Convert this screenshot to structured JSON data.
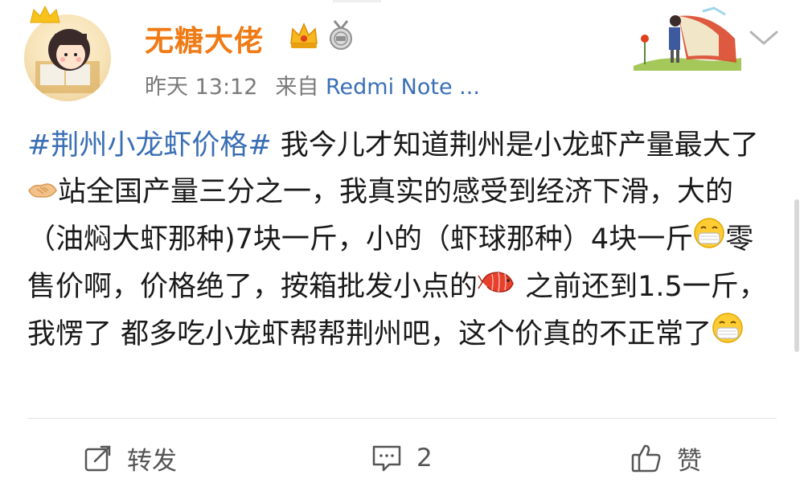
{
  "post": {
    "username": "无糖大佬",
    "time": "昨天 13:12",
    "source_prefix": "来自",
    "source_device": "Redmi Note ...",
    "content": {
      "topic": "#荆州小龙虾价格#",
      "seg1": " 我今儿才知道荆州是小龙虾产量最大了",
      "seg2": "站全国产量三分之一，我真实的感受到经济下滑，大的 （油焖大虾那种)7块一斤，小的（虾球那种）4块一斤",
      "seg3": "零售价啊，价格绝了，按箱批发小点的",
      "seg4": " 之前还到1.5一斤，我愣了 都多吃小龙虾帮帮荆州吧，这个价真的不正常了"
    }
  },
  "actions": {
    "repost_label": "转发",
    "comment_count": "2",
    "like_label": "赞"
  },
  "icons": {
    "avatar": "avatar-image",
    "vip_crown": "crown-icon",
    "medal": "medal-icon",
    "menu": "chevron-down-icon",
    "repost": "share-icon",
    "comment": "comment-icon",
    "like": "thumbs-up-icon",
    "emoji_handshake": "handshake-emoji",
    "emoji_mask": "mask-face-emoji",
    "emoji_shrimp": "shrimp-emoji"
  },
  "colors": {
    "username": "#f07a14",
    "topic_link": "#3a6fb5",
    "meta_text": "#7a7a7a"
  }
}
